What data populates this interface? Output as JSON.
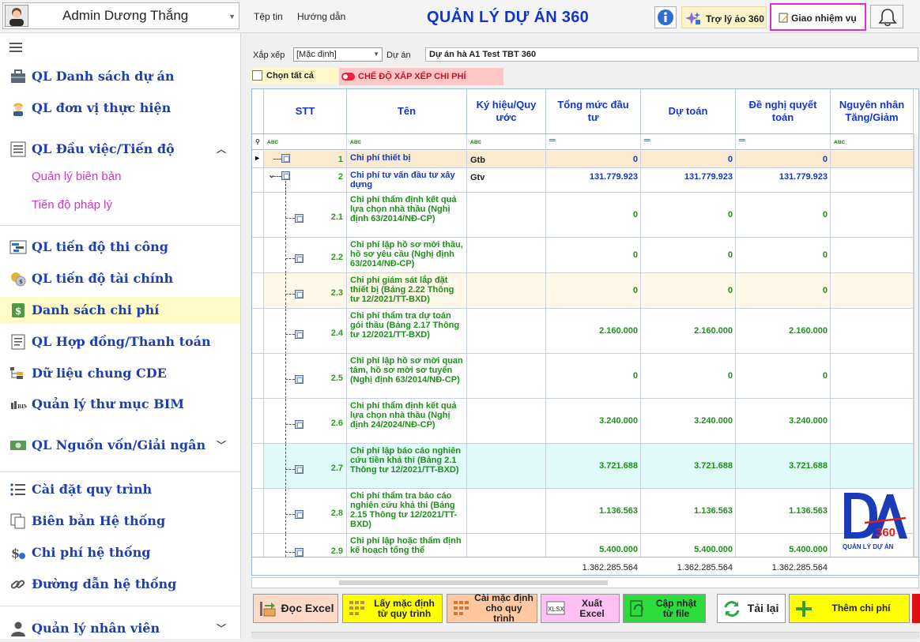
{
  "topbar": {
    "user_name": "Admin Dương Thắng",
    "menu": [
      "Tệp tin",
      "Hướng dẫn"
    ],
    "app_title": "QUẢN LÝ DỰ ÁN 360",
    "assistant_label": "Trợ lý ảo 360",
    "assign_label": "Giao nhiệm vụ"
  },
  "sidebar": {
    "items": [
      {
        "label": "QL Danh sách dự án",
        "icon": "briefcase-icon"
      },
      {
        "label": "QL đơn vị thực hiện",
        "icon": "worker-icon"
      },
      {
        "label": "QL Đầu việc/Tiến độ",
        "icon": "task-list-icon",
        "expanded": true
      },
      {
        "label": "QL tiến độ thi công",
        "icon": "gantt-icon"
      },
      {
        "label": "QL tiến độ tài chính",
        "icon": "coins-icon"
      },
      {
        "label": "Danh sách chi phí",
        "icon": "money-sheet-icon",
        "active": true
      },
      {
        "label": "QL Hợp đồng/Thanh toán",
        "icon": "contract-icon"
      },
      {
        "label": "Dữ liệu chung CDE",
        "icon": "tree-data-icon"
      },
      {
        "label": "Quản lý thư mục BIM",
        "icon": "bim-folder-icon"
      },
      {
        "label": "QL Nguồn vốn/Giải ngân",
        "icon": "banknote-icon",
        "expanded": false
      },
      {
        "label": "Cài đặt quy trình",
        "icon": "list-settings-icon"
      },
      {
        "label": "Biên bản Hệ thống",
        "icon": "copy-docs-icon"
      },
      {
        "label": "Chi phí hệ thống",
        "icon": "dollar-gear-icon"
      },
      {
        "label": "Đường dẫn hệ thống",
        "icon": "link-icon"
      },
      {
        "label": "Quản lý nhân viên",
        "icon": "user-icon",
        "expanded": false
      }
    ],
    "subitems": [
      "Quản lý biên bản",
      "Tiến độ pháp lý"
    ]
  },
  "filters": {
    "sort_label": "Xắp xếp",
    "sort_value": "[Mặc định]",
    "project_label": "Dự án",
    "project_value": "Dự án hà A1 Test TBT 360",
    "select_all_label": "Chọn tất cả",
    "cost_mode_label": "CHẾ ĐỘ XẮP XẾP CHI PHÍ"
  },
  "grid": {
    "columns": [
      "STT",
      "Tên",
      "Ký hiệu/Quy ước",
      "Tổng mức đầu tư",
      "Dự toán",
      "Đề nghị quyết toán",
      "Nguyên nhân Tăng/Giảm"
    ],
    "rows": [
      {
        "stt": "1",
        "name": "Chi phí thiết bị",
        "symbol": "Gtb",
        "tmdt": "0",
        "dutoan": "0",
        "denghi": "0",
        "level": 0
      },
      {
        "stt": "2",
        "name": "Chi phí tư vấn đầu tư xây dựng",
        "symbol": "Gtv",
        "tmdt": "131.779.923",
        "dutoan": "131.779.923",
        "denghi": "131.779.923",
        "level": 0
      },
      {
        "stt": "2.1",
        "name": "Chi phí thẩm định kết quả lựa chọn nhà thầu (Nghị định 63/2014/NĐ-CP)",
        "symbol": "",
        "tmdt": "0",
        "dutoan": "0",
        "denghi": "0",
        "level": 1
      },
      {
        "stt": "2.2",
        "name": "Chi phí lập hồ sơ mời thầu, hồ sơ yêu cầu (Nghị định 63/2014/NĐ-CP)",
        "symbol": "",
        "tmdt": "0",
        "dutoan": "0",
        "denghi": "0",
        "level": 1
      },
      {
        "stt": "2.3",
        "name": "Chi phí giám sát lắp đặt thiết bị (Bảng 2.22 Thông tư 12/2021/TT-BXD)",
        "symbol": "",
        "tmdt": "0",
        "dutoan": "0",
        "denghi": "0",
        "level": 1
      },
      {
        "stt": "2.4",
        "name": "Chi phí thẩm tra dự toán gói thầu (Bảng 2.17 Thông tư 12/2021/TT-BXD)",
        "symbol": "",
        "tmdt": "2.160.000",
        "dutoan": "2.160.000",
        "denghi": "2.160.000",
        "level": 1
      },
      {
        "stt": "2.5",
        "name": "Chi phí lập hồ sơ mời quan tâm, hồ sơ mời sơ tuyển (Nghị định 63/2014/NĐ-CP)",
        "symbol": "",
        "tmdt": "0",
        "dutoan": "0",
        "denghi": "0",
        "level": 1
      },
      {
        "stt": "2.6",
        "name": "Chi phí thẩm định kết quả lựa chọn nhà thầu (Nghị định 24/2024/NĐ-CP)",
        "symbol": "",
        "tmdt": "3.240.000",
        "dutoan": "3.240.000",
        "denghi": "3.240.000",
        "level": 1
      },
      {
        "stt": "2.7",
        "name": "Chi phí lập báo cáo nghiên cứu tiền khả thi (Bảng 2.1 Thông tư 12/2021/TT-BXD)",
        "symbol": "",
        "tmdt": "3.721.688",
        "dutoan": "3.721.688",
        "denghi": "3.721.688",
        "level": 1
      },
      {
        "stt": "2.8",
        "name": "Chi phí thẩm tra báo cáo nghiên cứu khả thi (Bảng 2.15 Thông tư 12/2021/TT-BXD)",
        "symbol": "",
        "tmdt": "1.136.563",
        "dutoan": "1.136.563",
        "denghi": "1.136.563",
        "level": 1
      },
      {
        "stt": "2.9",
        "name": "Chi phí lập hoặc thẩm định kế hoạch tổng thể",
        "symbol": "",
        "tmdt": "5.400.000",
        "dutoan": "5.400.000",
        "denghi": "5.400.000",
        "level": 1
      }
    ],
    "totals": {
      "tmdt": "1.362.285.564",
      "dutoan": "1.362.285.564",
      "denghi": "1.362.285.564"
    }
  },
  "logo": {
    "text": "360",
    "caption": "QUẢN LÝ DỰ ÁN"
  },
  "buttons": [
    {
      "label": "Đọc Excel",
      "icon": "excel-import-icon"
    },
    {
      "label": "Lấy mặc định từ quy trình",
      "icon": "grid-pull-icon"
    },
    {
      "label": "Cài mặc định cho quy trình",
      "icon": "grid-set-icon"
    },
    {
      "label": "Xuất Excel",
      "icon": "xlsx-export-icon"
    },
    {
      "label": "Cập nhật từ file",
      "icon": "file-update-icon"
    },
    {
      "label": "Tải lại",
      "icon": "refresh-icon"
    },
    {
      "label": "Thêm chi phí",
      "icon": "plus-icon"
    }
  ],
  "colors": {
    "title_blue": "#1436c8",
    "name_green": "#1e8f1a",
    "active_bg": "#fffbc7",
    "subitem_pink": "#d633c8",
    "assign_border": "#e02ec9"
  }
}
